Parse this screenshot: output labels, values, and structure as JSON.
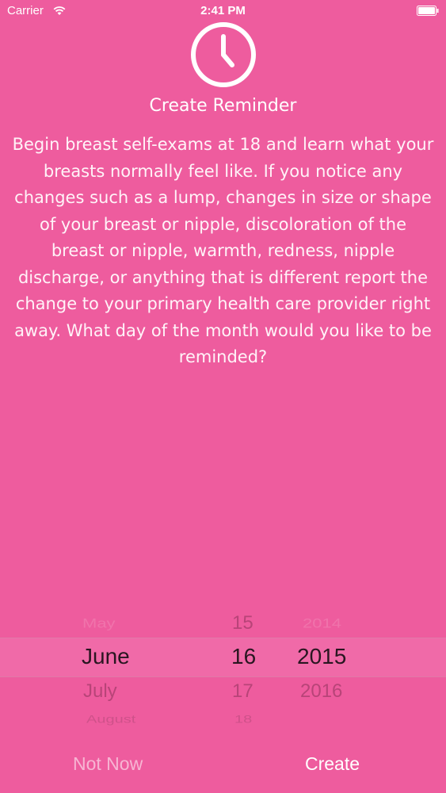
{
  "status_bar": {
    "carrier": "Carrier",
    "time": "2:41 PM",
    "wifi_icon": "wifi-icon",
    "battery_icon": "battery-icon"
  },
  "header": {
    "icon": "clock-icon",
    "title": "Create Reminder"
  },
  "message": "Begin breast self-exams at 18 and learn what your breasts normally feel like. If you notice any changes such as a lump, changes in size or shape of your breast or nipple, discoloration of the breast or nipple, warmth, redness, nipple discharge, or anything that is different report the change to your primary health care provider right away. What day of the month would you like to be reminded?",
  "picker": {
    "month": {
      "above_far": "",
      "above": "May",
      "selected": "June",
      "below": "July",
      "below_far": "August"
    },
    "day": {
      "above_far": "",
      "above": "15",
      "selected": "16",
      "below": "17",
      "below_far": "18"
    },
    "year": {
      "above_far": "",
      "above": "2014",
      "selected": "2015",
      "below": "2016",
      "below_far": ""
    }
  },
  "buttons": {
    "not_now": "Not Now",
    "create": "Create"
  },
  "colors": {
    "background": "#ee5c9e",
    "text": "#ffffff",
    "selected_text": "#2a1621"
  }
}
